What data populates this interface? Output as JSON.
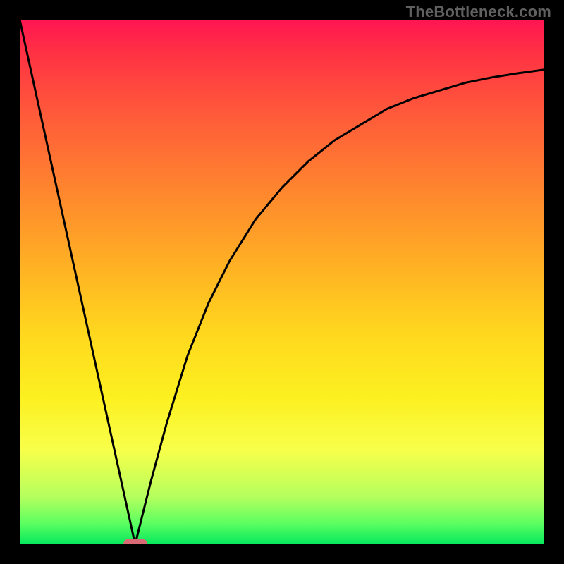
{
  "watermark": "TheBottleneck.com",
  "chart_data": {
    "type": "line",
    "title": "",
    "xlabel": "",
    "ylabel": "",
    "xlim": [
      0,
      100
    ],
    "ylim": [
      0,
      100
    ],
    "grid": false,
    "background_gradient": {
      "top": "#ff1552",
      "bottom": "#05e85e"
    },
    "series": [
      {
        "name": "left-branch",
        "path_type": "line",
        "x": [
          0,
          22
        ],
        "y": [
          100,
          0
        ]
      },
      {
        "name": "right-branch",
        "path_type": "curve",
        "x": [
          22,
          25,
          28,
          32,
          36,
          40,
          45,
          50,
          55,
          60,
          65,
          70,
          75,
          80,
          85,
          90,
          95,
          100
        ],
        "y": [
          0,
          12,
          23,
          36,
          46,
          54,
          62,
          68,
          73,
          77,
          80,
          83,
          85,
          86.5,
          88,
          89,
          89.8,
          90.5
        ]
      }
    ],
    "marker": {
      "x": 22,
      "y": 0,
      "color": "#d76a74"
    }
  }
}
